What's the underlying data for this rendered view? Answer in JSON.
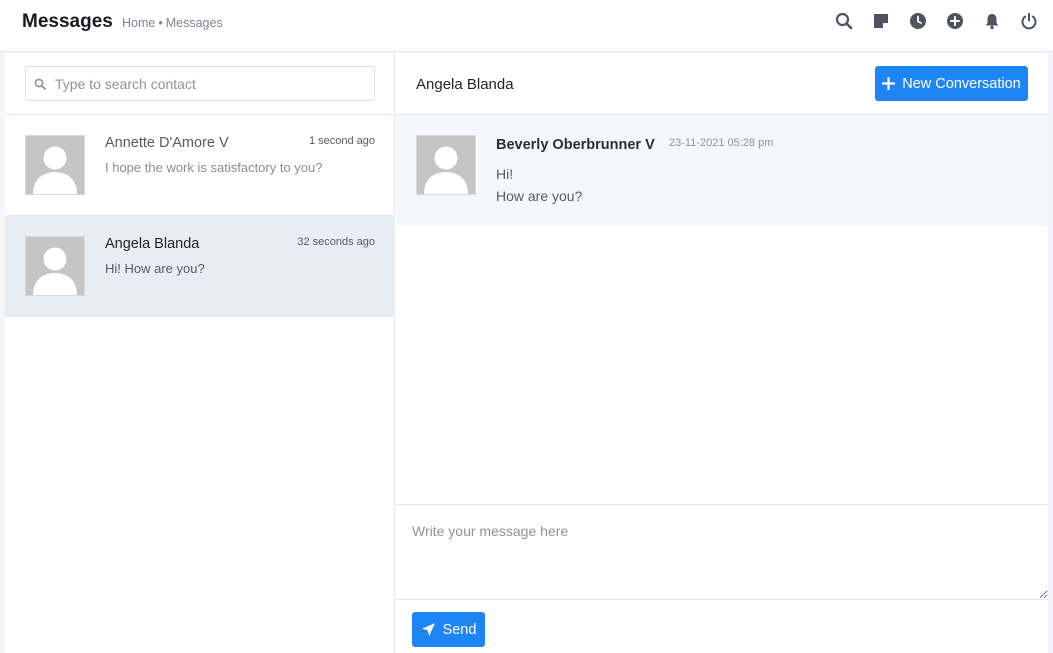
{
  "header": {
    "title": "Messages",
    "breadcrumb": {
      "home": "Home",
      "separator": "•",
      "current": "Messages"
    },
    "icons": [
      "search-icon",
      "sticky-note-icon",
      "clock-icon",
      "plus-circle-icon",
      "bell-icon",
      "power-icon"
    ]
  },
  "search": {
    "placeholder": "Type to search contact",
    "value": ""
  },
  "contacts": [
    {
      "name": "Annette D'Amore V",
      "time": "1 second ago",
      "preview": "I hope the work is satisfactory to you?",
      "active": false
    },
    {
      "name": "Angela Blanda",
      "time": "32 seconds ago",
      "preview": "Hi! How are you?",
      "active": true
    }
  ],
  "chat": {
    "title": "Angela Blanda",
    "new_conversation_label": "New Conversation",
    "messages": [
      {
        "author": "Beverly Oberbrunner V",
        "time": "23-11-2021 05:28 pm",
        "lines": [
          "Hi!",
          "How are you?"
        ]
      }
    ],
    "composer_placeholder": "Write your message here",
    "composer_value": "",
    "send_label": "Send"
  },
  "colors": {
    "accent": "#1e86f4",
    "active_contact_bg": "#e8edf4",
    "message_bg": "#f4f8fd"
  }
}
